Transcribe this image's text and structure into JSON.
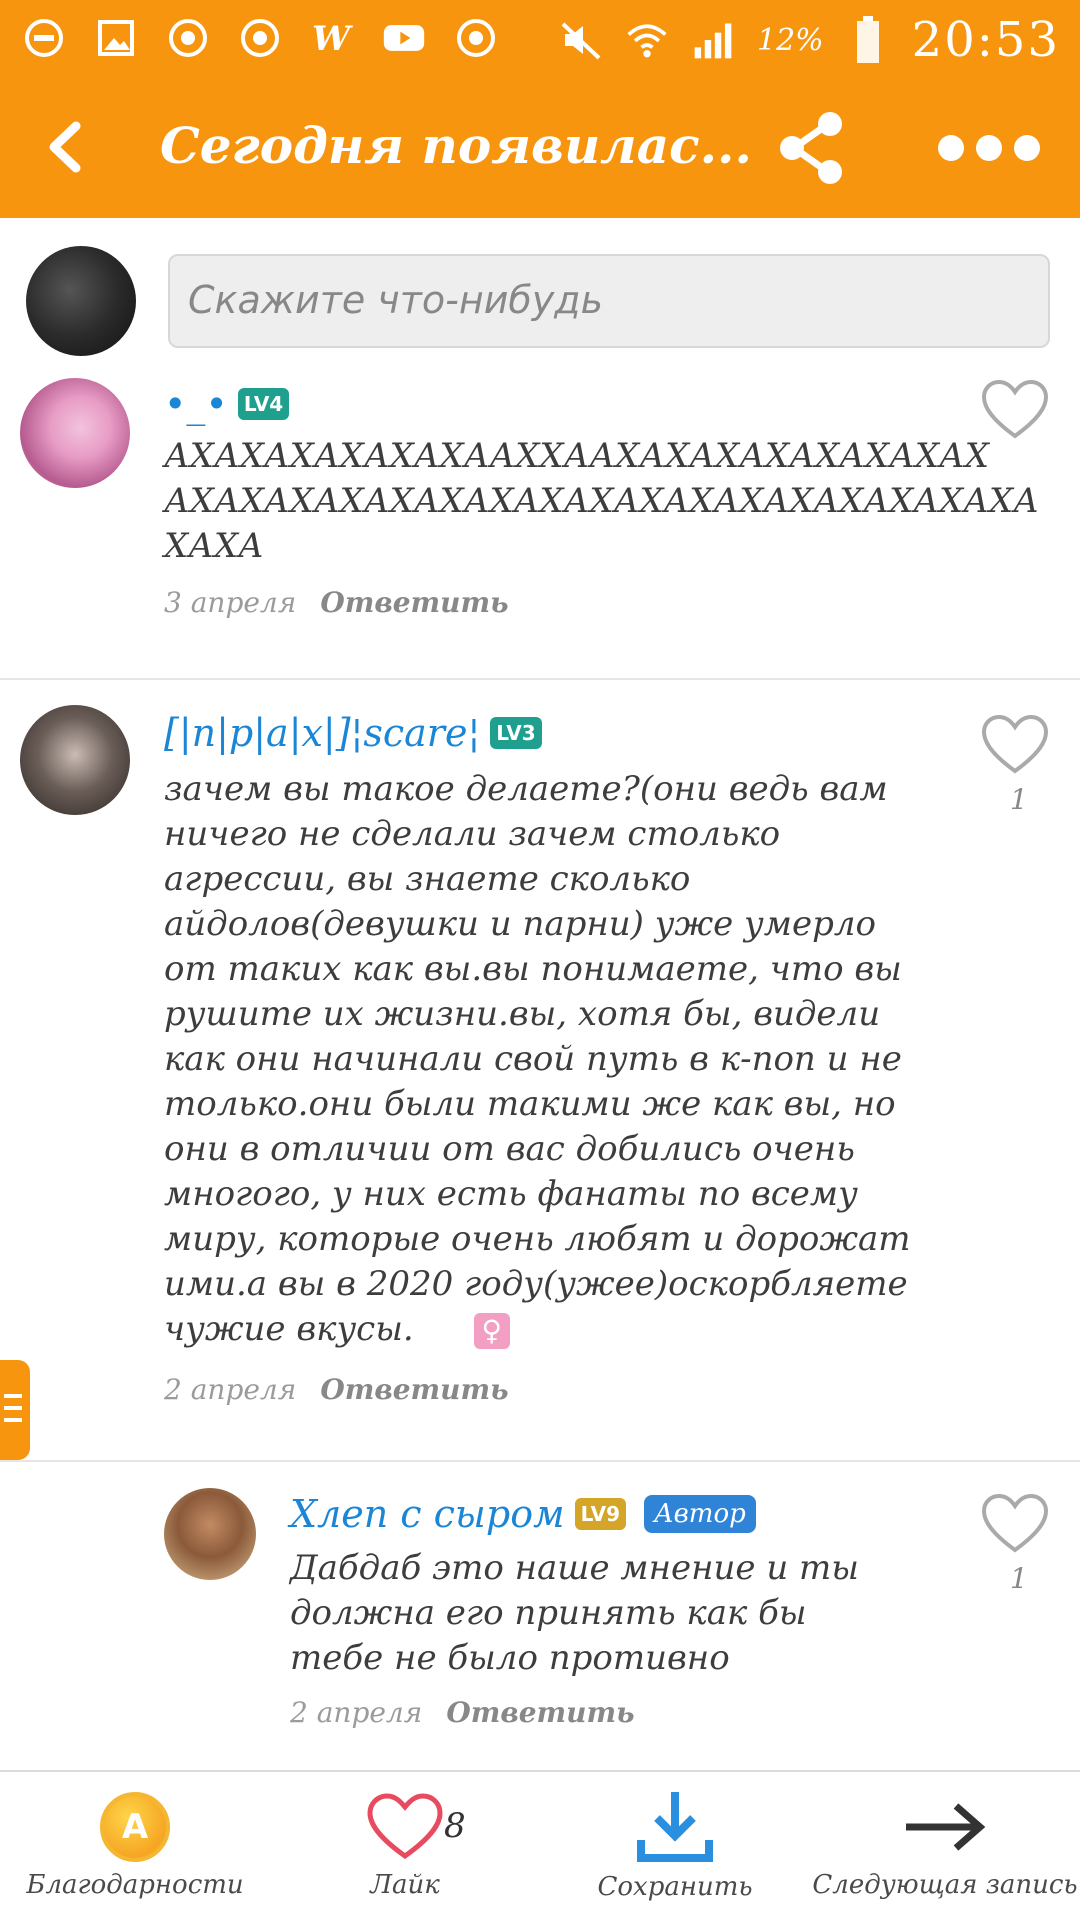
{
  "status_bar": {
    "battery_text": "12%",
    "time": "20:53"
  },
  "header": {
    "title": "Сегодня появилас..."
  },
  "compose": {
    "placeholder": "Скажите что-нибудь"
  },
  "comments": [
    {
      "author": "•_•",
      "level": "LV4",
      "text": "АХАХАХАХАХАХААХХААХАХАХАХАХАХАХАХ АХАХАХАХАХАХАХАХАХАХАХАХАХАХАХАХАХА ХАХА",
      "date": "3 апреля",
      "reply": "Ответить"
    },
    {
      "author": "[|п|р|а|х|]¦scare¦",
      "level": "LV3",
      "text": "зачем вы такое делаете?(они ведь вам ничего не сделали   зачем столько агрессии, вы знаете сколько айдолов(девушки и парни) уже умерло от таких как вы.вы понимаете, что вы рушите их жизни.вы, хотя бы, видели как они начинали свой путь в к-поп и не только.они были такими же как вы, но они в отличии от вас добились очень многого, у них есть фанаты по всему миру, которые очень любят и дорожат ими.а вы в 2020 году(ужее)оскорбляете чужие вкусы.",
      "emoji": "♀",
      "date": "2 апреля",
      "reply": "Ответить",
      "likes": "1"
    },
    {
      "author": "Хлеп с сыром",
      "level": "LV9",
      "badge": "Автор",
      "text": "Дабдаб это наше мнение и ты должна его принять как бы тебе не было противно",
      "date": "2 апреля",
      "reply": "Ответить",
      "likes": "1"
    }
  ],
  "bottom_bar": {
    "thanks_label": "Благодарности",
    "like_label": "Лайк",
    "like_count": "8",
    "save_label": "Сохранить",
    "next_label": "Следующая запись"
  },
  "colors": {
    "brand": "#f7950f",
    "link": "#1c86d6",
    "level_teal": "#1fa08f",
    "level_gold": "#d4a526"
  }
}
